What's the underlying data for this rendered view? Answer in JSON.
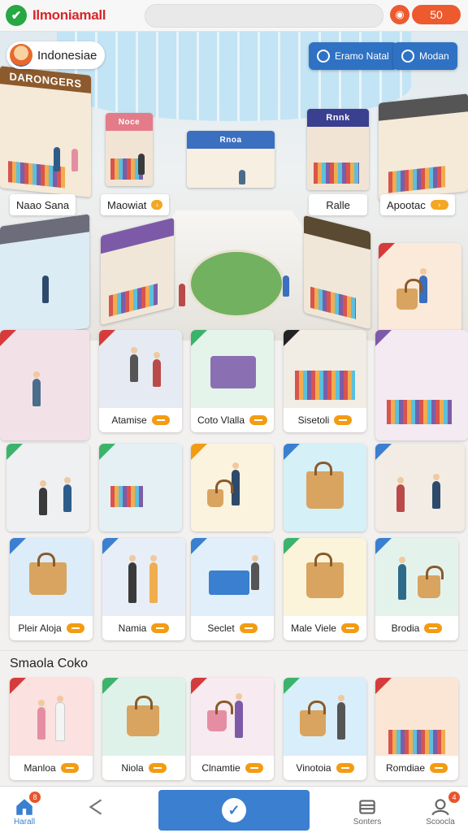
{
  "topbar": {
    "title": "Ilmoniamall",
    "checkmark": "✔",
    "record_icon": "record-icon",
    "pill_label": "50"
  },
  "header": {
    "brand_name": "Indonesiae",
    "button_primary": "Eramo Natal",
    "button_secondary": "Modan"
  },
  "stores": [
    {
      "sign": "DARONGERS",
      "label": "Naao Sana"
    },
    {
      "sign": "Noce",
      "label": "Maowiat"
    },
    {
      "sign": "Rnoa",
      "label": "Ralle"
    },
    {
      "sign": "Rnnk",
      "label": "Apootac"
    }
  ],
  "cards": [
    {
      "label": "Atamise",
      "corner": "#d63b3b"
    },
    {
      "label": "Coto Vlalla",
      "corner": "#3bb36b"
    },
    {
      "label": "Sisetoli",
      "corner": "#222222"
    },
    {
      "label": "",
      "corner": "#3bb36b"
    },
    {
      "label": "",
      "corner": "#3bb36b"
    },
    {
      "label": "",
      "corner": "#f39c12"
    },
    {
      "label": "",
      "corner": "#3b7fd0"
    },
    {
      "label": "",
      "corner": "#3b7fd0"
    },
    {
      "label": "Pleir Aloja",
      "corner": "#3b7fd0"
    },
    {
      "label": "Namia",
      "corner": "#3b7fd0"
    },
    {
      "label": "Seclet",
      "corner": "#3b7fd0"
    },
    {
      "label": "Male Viele",
      "corner": "#3bb36b"
    },
    {
      "label": "Brodia",
      "corner": "#3b7fd0"
    }
  ],
  "section": {
    "title": "Smaola Coko"
  },
  "section_cards": [
    {
      "label": "Manloa",
      "corner": "#d63b3b"
    },
    {
      "label": "Niola",
      "corner": "#3bb36b"
    },
    {
      "label": "Clnamtie",
      "corner": "#d63b3b"
    },
    {
      "label": "Vinotoia",
      "corner": "#3bb36b"
    },
    {
      "label": "Romdiae",
      "corner": "#d63b3b"
    }
  ],
  "nav": {
    "home_label": "Harall",
    "home_badge": "8",
    "share_label": "",
    "center_icon": "check-icon",
    "sorters_label": "Sonters",
    "profile_label": "Scoocla",
    "profile_badge": "4"
  },
  "colors": {
    "accent_red": "#d7262b",
    "accent_orange": "#ec5a2e",
    "accent_blue": "#3b7fd0",
    "tag_orange": "#f39c12"
  }
}
